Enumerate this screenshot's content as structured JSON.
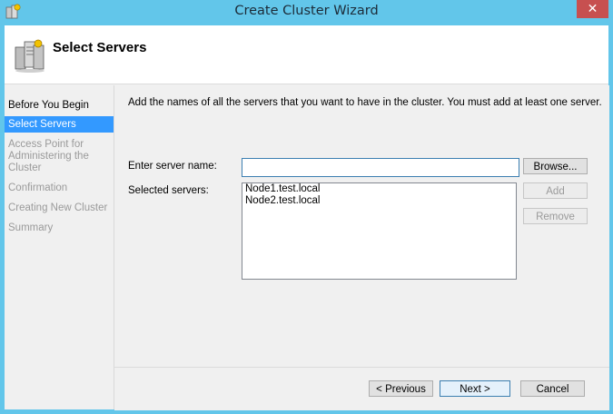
{
  "window": {
    "title": "Create Cluster Wizard",
    "close_label": "✕"
  },
  "header": {
    "title": "Select Servers"
  },
  "nav": {
    "items": [
      {
        "label": "Before You Begin",
        "state": "done"
      },
      {
        "label": "Select Servers",
        "state": "current"
      },
      {
        "label": "Access Point for Administering the Cluster",
        "state": "pending"
      },
      {
        "label": "Confirmation",
        "state": "pending"
      },
      {
        "label": "Creating New Cluster",
        "state": "pending"
      },
      {
        "label": "Summary",
        "state": "pending"
      }
    ]
  },
  "content": {
    "instruction": "Add the names of all the servers that you want to have in the cluster. You must add at least one server.",
    "server_name_label": "Enter server name:",
    "server_name_value": "",
    "selected_label": "Selected servers:",
    "selected_servers": [
      "Node1.test.local",
      "Node2.test.local"
    ],
    "browse_label": "Browse...",
    "add_label": "Add",
    "remove_label": "Remove"
  },
  "footer": {
    "previous_label": "< Previous",
    "next_label": "Next >",
    "cancel_label": "Cancel"
  },
  "colors": {
    "titlebar": "#62c6ea",
    "selection": "#3399ff",
    "close": "#c75050"
  }
}
